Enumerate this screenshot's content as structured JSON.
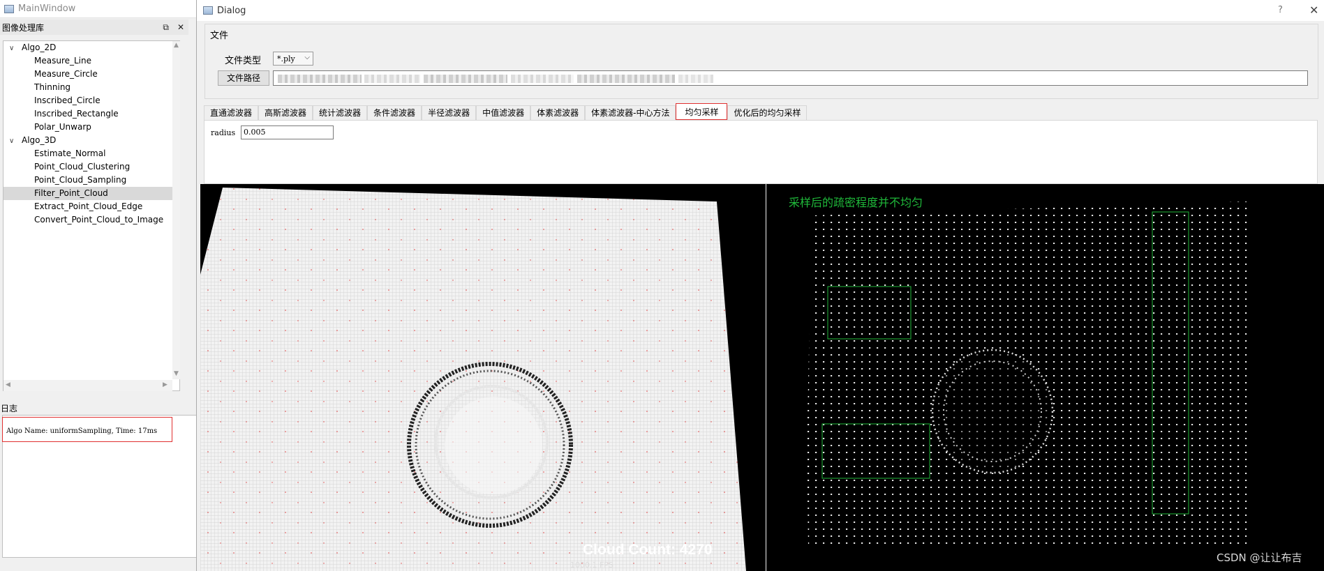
{
  "main_window": {
    "title": "MainWindow",
    "dock_title": "图像处理库",
    "dock_float_icon": "float-icon",
    "dock_close_icon": "close-icon",
    "tree": [
      {
        "label": "Algo_2D",
        "expanded": true,
        "children": [
          "Measure_Line",
          "Measure_Circle",
          "Thinning",
          "Inscribed_Circle",
          "Inscribed_Rectangle",
          "Polar_Unwarp"
        ]
      },
      {
        "label": "Algo_3D",
        "expanded": true,
        "children": [
          "Estimate_Normal",
          "Point_Cloud_Clustering",
          "Point_Cloud_Sampling",
          "Filter_Point_Cloud",
          "Extract_Point_Cloud_Edge",
          "Convert_Point_Cloud_to_Image"
        ]
      }
    ],
    "selected_item": "Filter_Point_Cloud",
    "log_title": "日志",
    "log_lines": [
      "Algo Name: uniformSampling, Time: 17ms"
    ]
  },
  "dialog": {
    "title": "Dialog",
    "help": "?",
    "close": "✕",
    "file_group": {
      "title": "文件",
      "file_type_label": "文件类型",
      "file_type_value": "*.ply",
      "file_path_button": "文件路径"
    },
    "tabs": [
      "直通滤波器",
      "高斯滤波器",
      "统计滤波器",
      "条件滤波器",
      "半径滤波器",
      "中值滤波器",
      "体素滤波器",
      "体素滤波器-中心方法",
      "均匀采样",
      "优化后的均匀采样"
    ],
    "active_tab": "均匀采样",
    "radius_label": "radius",
    "radius_value": "0.005",
    "right_view_overlay": "采样后的疏密程度并不均匀",
    "cloud_count": "Cloud Count: 4270",
    "fps": "1000.1 FPS",
    "colors": {
      "highlight_border": "#e03030",
      "annotation_green": "#1fb93a"
    }
  },
  "watermark": "CSDN @让让布吉"
}
